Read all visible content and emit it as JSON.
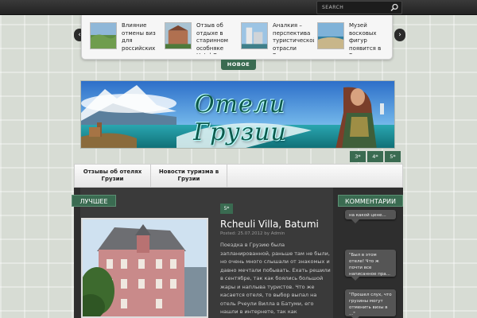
{
  "search": {
    "placeholder": "SEARCH"
  },
  "slider": {
    "prev": "‹",
    "next": "›",
    "items": [
      {
        "caption": "Влияние отмены виз для российских туристов на"
      },
      {
        "caption": "Отзыв об отдыхе в старинном особняке Hotel O."
      },
      {
        "caption": "Аналкия – перспектива туристической отрасли Грузии"
      },
      {
        "caption": "Музей восковых фигур появится в Грузии"
      }
    ],
    "tab_label": "НОВОЕ"
  },
  "banner": {
    "title": "Отели Грузии",
    "pages": [
      "3*",
      "4*",
      "5*"
    ]
  },
  "nav": {
    "items": [
      {
        "label": "Отзывы об отелях Грузии"
      },
      {
        "label": "Новости туризма в Грузии"
      }
    ]
  },
  "sections": {
    "best": "ЛУЧШЕЕ",
    "comments": "КОММЕНТАРИИ"
  },
  "post": {
    "rating": "5*",
    "title": "Rcheuli Villa, Batumi",
    "meta": "Posted: 25.07.2012 by Admin",
    "body": "Поездка в Грузию была запланированной, раньше там не были, но очень много слышали от знакомых и давно мечтали побывать. Ехать решили в сентябре, так как боялись большой жары и наплыва туристов. Что же касается отеля, то выбор выпал на отель Рчеули Вилла в Батуми, его нашли в интернете, так как организацией поездки"
  },
  "comments": [
    {
      "text": "на какой цене..."
    },
    {
      "text": "\"Был в этом отеле! Что ж почти все написанное пра..."
    },
    {
      "text": "\"Прошел слух, что грузины могут отменить визы в ...\""
    }
  ],
  "colors": {
    "accent_green": "#3a6b51",
    "dark_bg": "#2e2e2e",
    "page_bg": "#d7dcd4"
  }
}
